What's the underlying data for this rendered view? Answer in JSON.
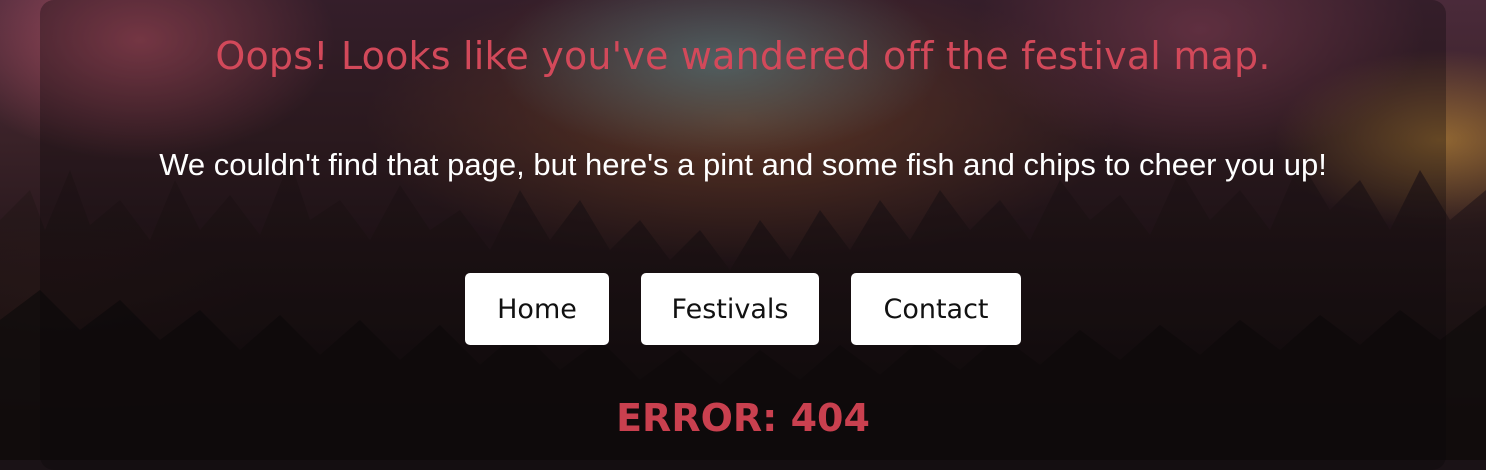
{
  "page": {
    "headline": "Oops! Looks like you've wandered off the festival map.",
    "message": "We couldn't find that page, but here's a pint and some fish and chips to cheer you up!",
    "error_code": "ERROR: 404"
  },
  "nav": {
    "home_label": "Home",
    "festivals_label": "Festivals",
    "contact_label": "Contact"
  },
  "colors": {
    "accent": "#d2495a",
    "error": "#c9404f",
    "button_bg": "#ffffff",
    "message_text": "#ffffff"
  },
  "background": {
    "icon": "concert-crowd-photo"
  }
}
